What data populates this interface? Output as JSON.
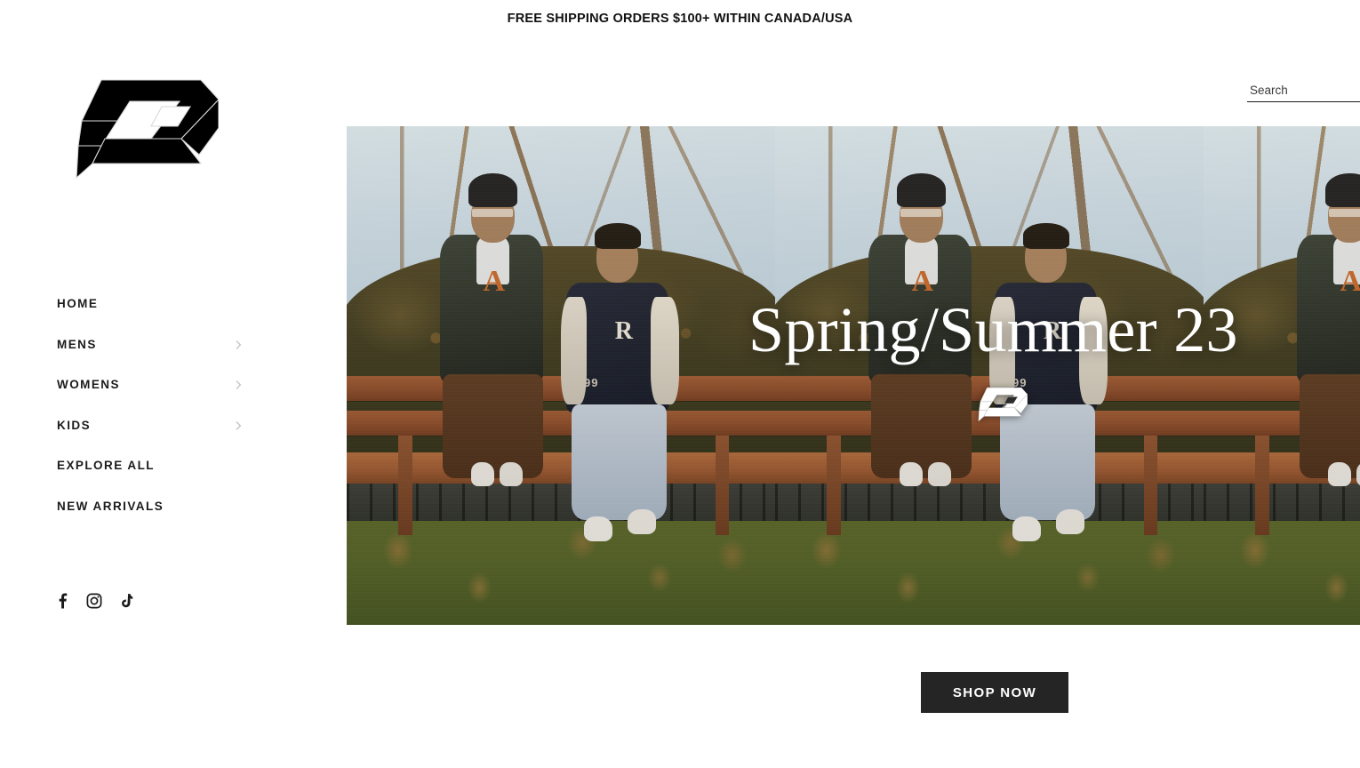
{
  "announcement": {
    "text": "FREE SHIPPING ORDERS $100+ WITHIN CANADA/USA"
  },
  "brand": {
    "logo_icon": "isometric-3d-monogram-logo",
    "logo_color": "#000000"
  },
  "search": {
    "placeholder": "Search",
    "value": "",
    "icon": "search-input-underline"
  },
  "sidebar": {
    "nav": [
      {
        "label": "HOME",
        "has_submenu": false,
        "chevron_icon": null
      },
      {
        "label": "MENS",
        "has_submenu": true,
        "chevron_icon": "chevron-right-icon"
      },
      {
        "label": "WOMENS",
        "has_submenu": true,
        "chevron_icon": "chevron-right-icon"
      },
      {
        "label": "KIDS",
        "has_submenu": true,
        "chevron_icon": "chevron-right-icon"
      },
      {
        "label": "EXPLORE ALL",
        "has_submenu": false,
        "chevron_icon": null
      },
      {
        "label": "NEW ARRIVALS",
        "has_submenu": false,
        "chevron_icon": null
      }
    ],
    "social": [
      {
        "name": "Facebook",
        "icon": "facebook-icon"
      },
      {
        "name": "Instagram",
        "icon": "instagram-icon"
      },
      {
        "name": "TikTok",
        "icon": "tiktok-icon"
      }
    ]
  },
  "hero": {
    "title": "Spring/Summer 23",
    "watermark_icon": "brand-mark-white",
    "scene_description": "Two men seated on a brown park bench outdoors in front of a hedge and bare trees, autumn grass with fallen leaves",
    "figure_one": {
      "letter": "A",
      "letter_color": "#c2652a",
      "jacket": "dark green",
      "headwear": "black beanie"
    },
    "figure_two": {
      "letter": "R",
      "number": "99",
      "jacket": "navy and cream varsity"
    },
    "repeat_count": 3
  },
  "cta": {
    "shop_label": "SHOP NOW",
    "background": "#252525",
    "text_color": "#ffffff"
  }
}
